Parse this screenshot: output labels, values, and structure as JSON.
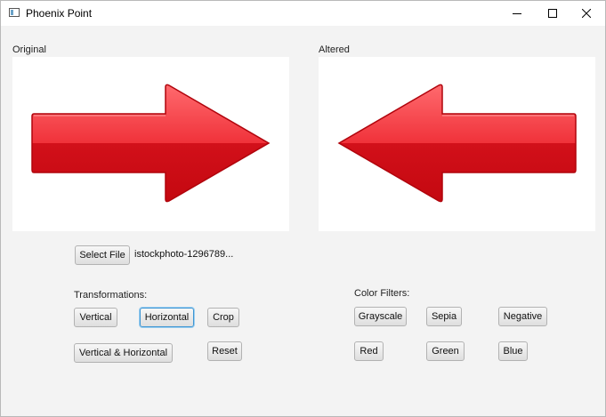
{
  "window": {
    "title": "Phoenix Point"
  },
  "panes": {
    "original_label": "Original",
    "altered_label": "Altered"
  },
  "file": {
    "select_label": "Select File",
    "name": "istockphoto-1296789..."
  },
  "transformations": {
    "label": "Transformations:",
    "vertical": "Vertical",
    "horizontal": "Horizontal",
    "crop": "Crop",
    "vertical_horizontal": "Vertical & Horizontal",
    "reset": "Reset"
  },
  "filters": {
    "label": "Color Filters:",
    "grayscale": "Grayscale",
    "sepia": "Sepia",
    "negative": "Negative",
    "red": "Red",
    "green": "Green",
    "blue": "Blue"
  },
  "images": {
    "original_icon": "arrow-right-icon",
    "altered_icon": "arrow-left-icon",
    "arrow_color": "#e0141b"
  },
  "colors": {
    "focus": "#3c95d3",
    "window_bg": "#f3f3f3"
  }
}
